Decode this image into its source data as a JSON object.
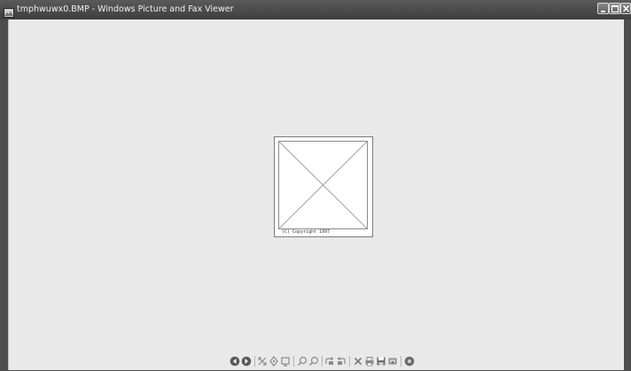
{
  "window": {
    "title": "tmphwuwx0.BMP - Windows Picture and Fax Viewer",
    "icon": "picture-viewer-icon",
    "buttons": [
      "minimize-icon",
      "maximize-icon",
      "close-icon"
    ]
  },
  "viewer": {
    "image_caption": "(C) Copyright 1997",
    "image_placeholder": "broken-image-x"
  },
  "toolbar": {
    "buttons": [
      {
        "name": "previous-image-button",
        "icon": "previous-icon"
      },
      {
        "name": "next-image-button",
        "icon": "next-icon"
      },
      {
        "name": "best-fit-button",
        "icon": "best-fit-icon"
      },
      {
        "name": "actual-size-button",
        "icon": "actual-size-icon"
      },
      {
        "name": "slideshow-button",
        "icon": "slideshow-icon"
      },
      {
        "name": "zoom-in-button",
        "icon": "zoom-in-icon"
      },
      {
        "name": "zoom-out-button",
        "icon": "zoom-out-icon"
      },
      {
        "name": "rotate-clockwise-button",
        "icon": "rotate-clockwise-icon"
      },
      {
        "name": "rotate-counterclockwise-button",
        "icon": "rotate-counterclockwise-icon"
      },
      {
        "name": "delete-button",
        "icon": "delete-icon"
      },
      {
        "name": "print-button",
        "icon": "print-icon"
      },
      {
        "name": "copy-to-button",
        "icon": "save-icon"
      },
      {
        "name": "edit-button",
        "icon": "edit-icon"
      },
      {
        "name": "help-button",
        "icon": "help-icon"
      }
    ]
  },
  "colors": {
    "titlebar": "#4a4a4a",
    "client_background": "#e9e9e9",
    "toolbar_icon": "#6a6a6a"
  }
}
